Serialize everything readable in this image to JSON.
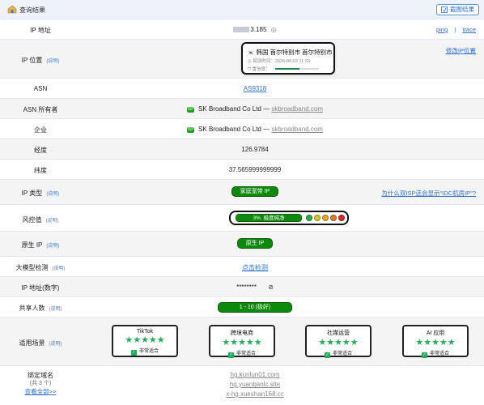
{
  "header": {
    "title": "查询结果",
    "screenshot_button": "截图结果"
  },
  "rows": {
    "ip": {
      "label": "IP 地址",
      "value": "3.185",
      "links": [
        "ping",
        "|",
        "trace"
      ]
    },
    "location": {
      "label": "IP 位置",
      "hint": "(说明)",
      "country_flag": "🇰🇷",
      "place": "韩国 首尔特别市 首尔特别市",
      "time_label": "探测时间：",
      "time_value": "2026-08-03 11:33",
      "confidence_label": "置信度：",
      "confidence": 0.55,
      "right_link": "修改IP位置"
    },
    "asn": {
      "label": "ASN",
      "value": "AS9318"
    },
    "asn_owner": {
      "label": "ASN 所有者",
      "badge": "ISP",
      "name": "SK Broadband Co Ltd",
      "sep": " — ",
      "domain": "skbroadband.com"
    },
    "company": {
      "label": "企业",
      "badge": "ISP",
      "name": "SK Broadband Co Ltd",
      "sep": " — ",
      "domain": "skbroadband.com"
    },
    "longitude": {
      "label": "经度",
      "value": "126.9784"
    },
    "latitude": {
      "label": "纬度",
      "value": "37.565999999999"
    },
    "ip_type": {
      "label": "IP 类型",
      "hint": "(说明)",
      "value": "家庭宽带 IP",
      "right_link": "为什么双ISP还会显示\"IDC机房IP\"?"
    },
    "risk": {
      "label": "风控值",
      "hint": "(说明)",
      "percent": "3%",
      "text": "极度纯净",
      "level": 0.03,
      "dots": [
        "#2ea84a",
        "#d6c52a",
        "#e8a52a",
        "#e07a2a",
        "#d62a2a"
      ]
    },
    "native": {
      "label": "原生 IP",
      "hint": "(说明)",
      "value": "原生 IP"
    },
    "llm": {
      "label": "大模型检测",
      "hint": "(说明)",
      "value": "点击检测"
    },
    "ip_numeric": {
      "label": "IP 地址(数字)",
      "value": "********"
    },
    "shared": {
      "label": "共享人数",
      "hint": "(说明)",
      "value": "1 - 10 (极好)"
    },
    "scenes": {
      "label": "适用场景",
      "hint": "(说明)",
      "items": [
        {
          "title": "TikTok",
          "stars": "★★★★★",
          "status": "非常适合"
        },
        {
          "title": "跨境电商",
          "stars": "★★★★★",
          "status": "非常适合"
        },
        {
          "title": "社媒运营",
          "stars": "★★★★★",
          "status": "非常适合"
        },
        {
          "title": "AI 应用",
          "stars": "★★★★★",
          "status": "非常适合"
        }
      ]
    },
    "domains": {
      "label": "绑定域名",
      "count": "(共 3 个)",
      "view_all": "查看全部>>",
      "items": [
        "hg.kunlun01.com",
        "hg.yuanbaolc.site",
        "x-hg.xueshan168.cc"
      ]
    }
  },
  "colors": {
    "accent": "#2f6fd6",
    "green": "#0d8a0d",
    "header_bg": "#eef2fb"
  }
}
